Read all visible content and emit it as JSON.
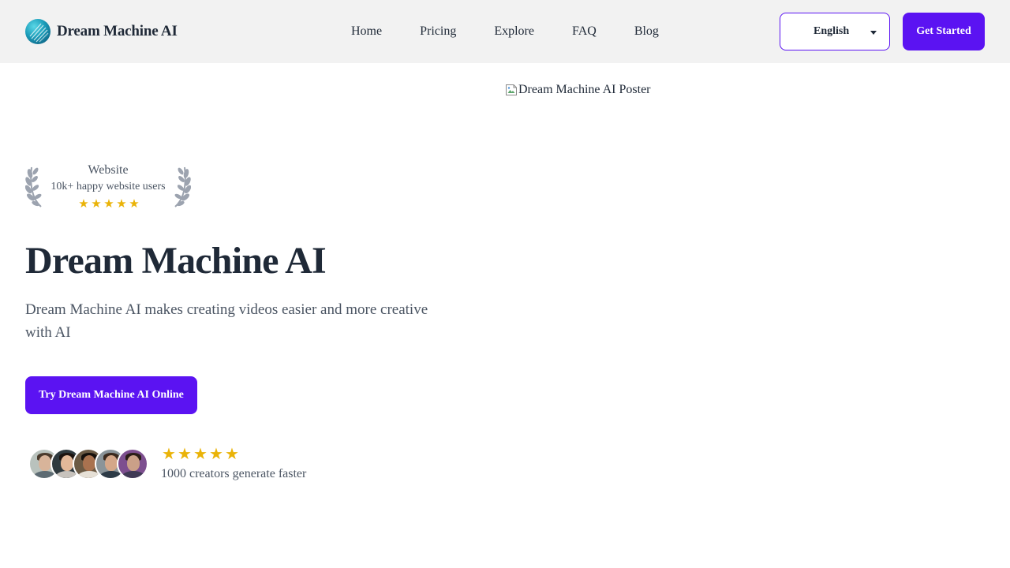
{
  "header": {
    "brand_name": "Dream Machine AI",
    "nav": [
      {
        "label": "Home"
      },
      {
        "label": "Pricing"
      },
      {
        "label": "Explore"
      },
      {
        "label": "FAQ"
      },
      {
        "label": "Blog"
      }
    ],
    "language": {
      "selected": "English"
    },
    "cta_label": "Get Started"
  },
  "poster": {
    "alt_text": "Dream Machine AI Poster"
  },
  "award": {
    "title": "Website",
    "subtitle": "10k+ happy website users",
    "rating": 5
  },
  "hero": {
    "title": "Dream Machine AI",
    "description": "Dream Machine AI makes creating videos easier and more creative with AI",
    "cta_label": "Try Dream Machine AI Online"
  },
  "social_proof": {
    "rating": 5,
    "text": "1000 creators generate faster",
    "avatar_count": 5
  },
  "colors": {
    "primary": "#5b13f2",
    "star": "#eab308",
    "header_bg": "#f2f2f2",
    "text_dark": "#1f2937",
    "text_muted": "#4b5563"
  },
  "icons": {
    "logo": "brand-logo-icon",
    "language_caret": "chevron-down-icon",
    "broken_image": "broken-image-icon",
    "laurel": "laurel-wreath-icon",
    "star": "star-icon"
  }
}
